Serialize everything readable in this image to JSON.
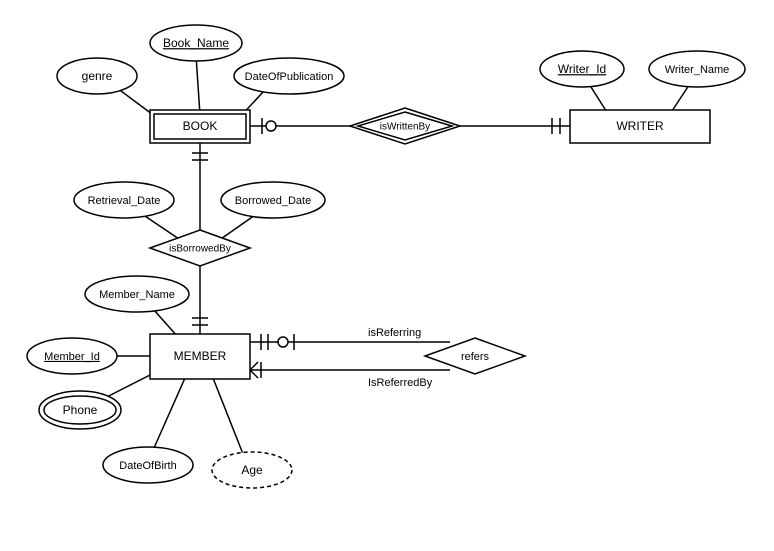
{
  "entities": {
    "book": "BOOK",
    "writer": "WRITER",
    "member": "MEMBER"
  },
  "relationships": {
    "isWrittenBy": "isWrittenBy",
    "isBorrowedBy": "isBorrowedBy",
    "refers": "refers"
  },
  "attributes": {
    "book_name": "Book_Name",
    "genre": "genre",
    "dateOfPublication": "DateOfPublication",
    "writer_id": "Writer_Id",
    "writer_name": "Writer_Name",
    "retrieval_date": "Retrieval_Date",
    "borrowed_date": "Borrowed_Date",
    "member_name": "Member_Name",
    "member_id": "Member_Id",
    "phone": "Phone",
    "dateOfBirth": "DateOfBirth",
    "age": "Age"
  },
  "roleLabels": {
    "isReferring": "isReferring",
    "isReferredBy": "IsReferredBy"
  }
}
